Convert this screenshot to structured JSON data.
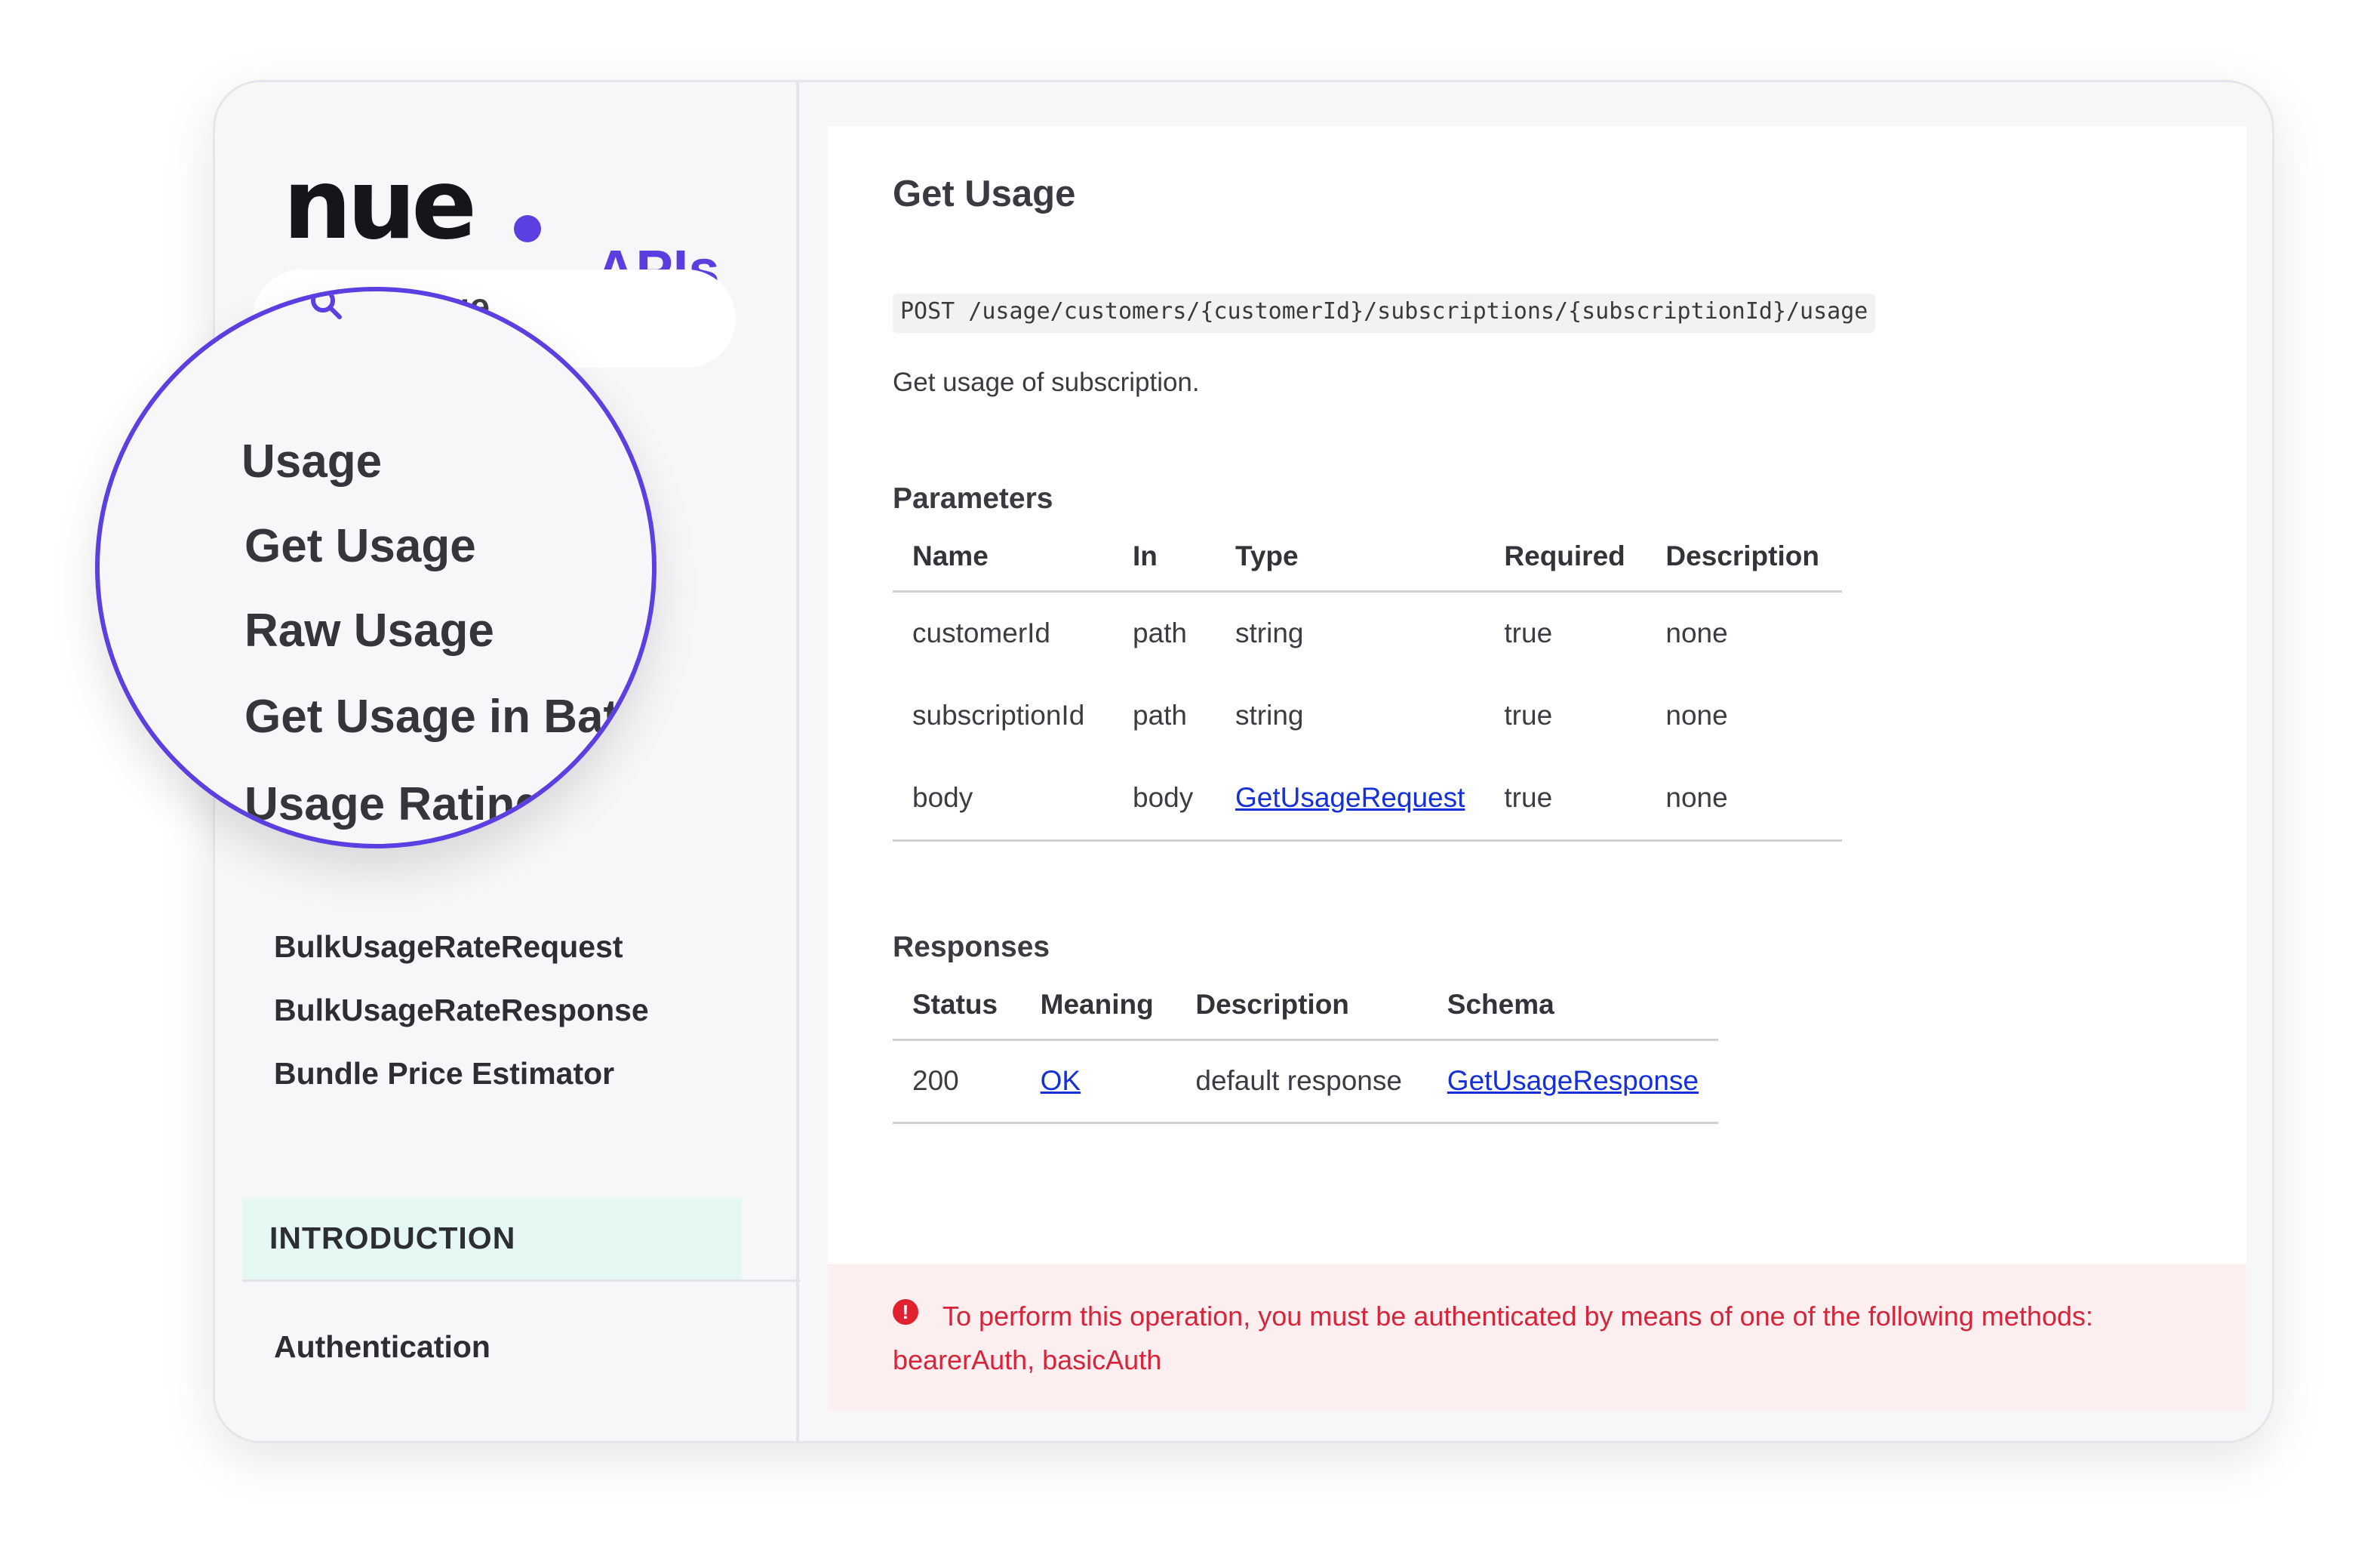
{
  "brand": {
    "logo": "nue",
    "product": "APIs"
  },
  "search": {
    "value": "Usage"
  },
  "magnified_nav": {
    "section": "Usage",
    "items": [
      "Get Usage",
      "Raw Usage",
      "Get Usage in Batch",
      "Usage Rating"
    ]
  },
  "sidebar": {
    "items": [
      "BulkUsageRateRequest",
      "BulkUsageRateResponse",
      "Bundle Price Estimator"
    ],
    "intro_section": "INTRODUCTION",
    "intro_item": "Authentication"
  },
  "page": {
    "title": "Get Usage",
    "endpoint": "POST /usage/customers/{customerId}/subscriptions/{subscriptionId}/usage",
    "description": "Get usage of subscription."
  },
  "parameters": {
    "heading": "Parameters",
    "columns": [
      "Name",
      "In",
      "Type",
      "Required",
      "Description"
    ],
    "rows": [
      [
        "customerId",
        "path",
        "string",
        "true",
        "none"
      ],
      [
        "subscriptionId",
        "path",
        "string",
        "true",
        "none"
      ],
      [
        "body",
        "body",
        "GetUsageRequest",
        "true",
        "none"
      ]
    ]
  },
  "responses": {
    "heading": "Responses",
    "columns": [
      "Status",
      "Meaning",
      "Description",
      "Schema"
    ],
    "rows": [
      [
        "200",
        "OK",
        "default response",
        "GetUsageResponse"
      ]
    ]
  },
  "alert": {
    "icon": "exclamation-circle-icon",
    "text": "To perform this operation, you must be authenticated by means of one of the following methods: bearerAuth, basicAuth"
  },
  "colors": {
    "accent": "#5b3fe0",
    "link": "#1530d6",
    "alert_text": "#d6253b",
    "alert_bg": "#fdeef0",
    "intro_bg": "#e6f8f4"
  }
}
